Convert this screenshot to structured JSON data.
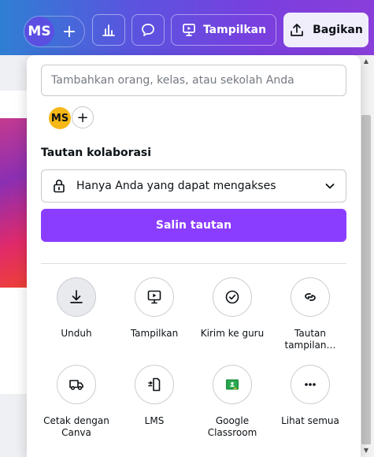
{
  "topbar": {
    "avatar_initials": "MS",
    "add_symbol": "+",
    "present_label": "Tampilkan",
    "share_label": "Bagikan",
    "icons": [
      "plus-icon",
      "chart-icon",
      "comment-icon",
      "present-icon",
      "upload-icon"
    ]
  },
  "panel": {
    "invite_placeholder": "Tambahkan orang, kelas, atau sekolah Anda",
    "member_initials": "MS",
    "member_add_symbol": "+",
    "collab_title": "Tautan kolaborasi",
    "access_value": "Hanya Anda yang dapat mengakses",
    "copy_label": "Salin tautan",
    "options": [
      {
        "label": "Unduh",
        "icon": "download-icon"
      },
      {
        "label": "Tampilkan",
        "icon": "present-icon"
      },
      {
        "label": "Kirim ke guru",
        "icon": "check-circle-icon"
      },
      {
        "label": "Tautan tampilan…",
        "icon": "link-icon"
      },
      {
        "label": "Cetak dengan Canva",
        "icon": "truck-icon"
      },
      {
        "label": "LMS",
        "icon": "lms-icon"
      },
      {
        "label": "Google Classroom",
        "icon": "classroom-icon"
      },
      {
        "label": "Lihat semua",
        "icon": "more-icon"
      }
    ]
  },
  "colors": {
    "accent": "#8b3dff",
    "member_avatar": "#f6b817",
    "topbar_start": "#2f7fd3",
    "topbar_end": "#8a3ed9"
  }
}
